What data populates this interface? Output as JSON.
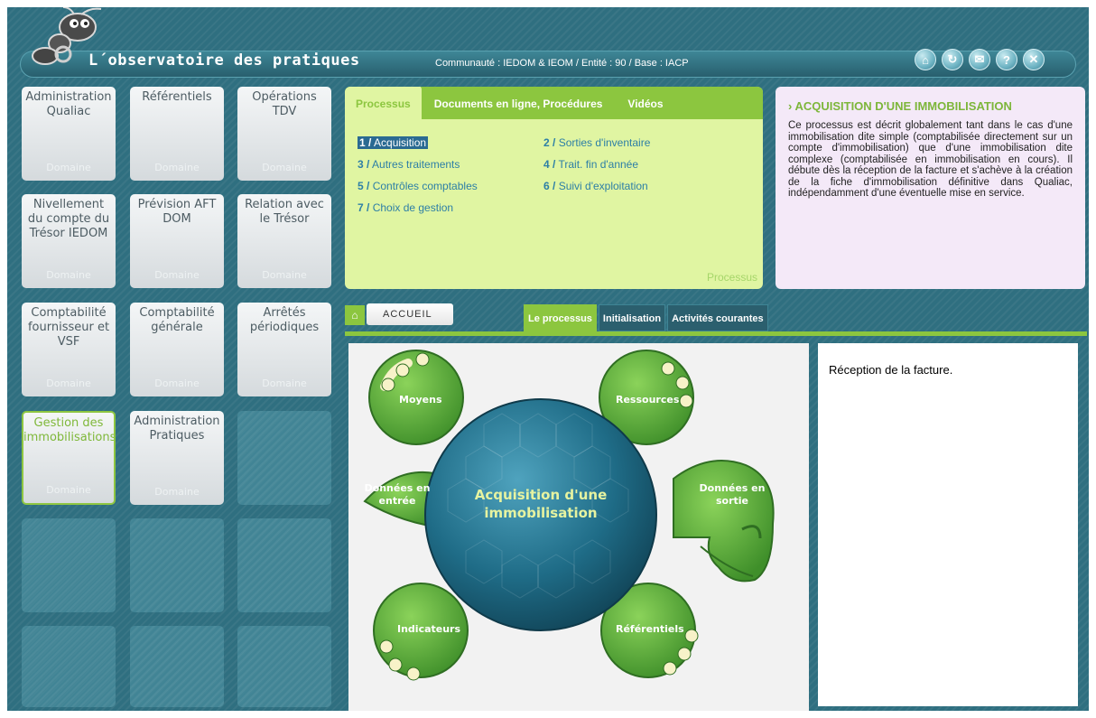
{
  "app": {
    "title": "L´observatoire des pratiques",
    "context": "Communauté : IEDOM & IEOM / Entité : 90 / Base : IACP"
  },
  "header_icons": [
    "home-icon",
    "refresh-icon",
    "mail-icon",
    "help-icon",
    "close-icon"
  ],
  "header_icon_glyphs": [
    "⌂",
    "↻",
    "✉",
    "?",
    "✕"
  ],
  "domains": [
    {
      "title": "Administration\nQualiac",
      "sub": "Domaine"
    },
    {
      "title": "Référentiels",
      "sub": "Domaine"
    },
    {
      "title": "Opérations\nTDV",
      "sub": "Domaine"
    },
    {
      "title": "Nivellement\ndu compte du\nTrésor IEDOM",
      "sub": "Domaine"
    },
    {
      "title": "Prévision AFT\nDOM",
      "sub": "Domaine"
    },
    {
      "title": "Relation avec\nle Trésor",
      "sub": "Domaine"
    },
    {
      "title": "Comptabilité\nfournisseur et\nVSF",
      "sub": "Domaine"
    },
    {
      "title": "Comptabilité\ngénérale",
      "sub": "Domaine"
    },
    {
      "title": "Arrêtés\npériodiques",
      "sub": "Domaine"
    },
    {
      "title": "Gestion des\nimmobilisations",
      "sub": "Domaine"
    },
    {
      "title": "Administration\nPratiques",
      "sub": "Domaine"
    }
  ],
  "process_panel": {
    "tabs": [
      "Processus",
      "Documents en ligne, Procédures",
      "Vidéos"
    ],
    "links": [
      {
        "num": "1 /",
        "label": "Acquisition"
      },
      {
        "num": "2 /",
        "label": "Sorties d'inventaire"
      },
      {
        "num": "3 /",
        "label": "Autres traitements"
      },
      {
        "num": "4 /",
        "label": "Trait. fin d'année"
      },
      {
        "num": "5 /",
        "label": "Contrôles comptables"
      },
      {
        "num": "6 /",
        "label": "Suivi d'exploitation"
      },
      {
        "num": "7 /",
        "label": "Choix de gestion"
      }
    ],
    "footer": "Processus"
  },
  "description": {
    "title": "› ACQUISITION D'UNE IMMOBILISATION",
    "text": "Ce processus est décrit globalement tant dans le cas d'une immobilisation dite simple (comptabilisée directement sur un compte d'immobilisation) que d'une immobilisation dite complexe (comptabilisée en immobilisation en cours). Il débute dès la réception de la facture et s'achève à la création de la fiche d'immobilisation définitive dans Qualiac, indépendamment d'une éventuelle mise en service."
  },
  "nav": {
    "home": "⌂",
    "accueil": "ACCUEIL",
    "tabs": [
      "Le processus",
      "Initialisation",
      "Activités courantes"
    ]
  },
  "diagram": {
    "center": "Acquisition d'une\nimmobilisation",
    "moyens": "Moyens",
    "ressources": "Ressources",
    "entree": "Données en\nentrée",
    "sortie": "Données en\nsortie",
    "indicateurs": "Indicateurs",
    "referentiels": "Référentiels"
  },
  "output": {
    "text": "Réception de la facture."
  },
  "colors": {
    "accent_green": "#8cc63f",
    "frame_teal": "#2f6f80",
    "link_blue": "#2d7fa6"
  }
}
